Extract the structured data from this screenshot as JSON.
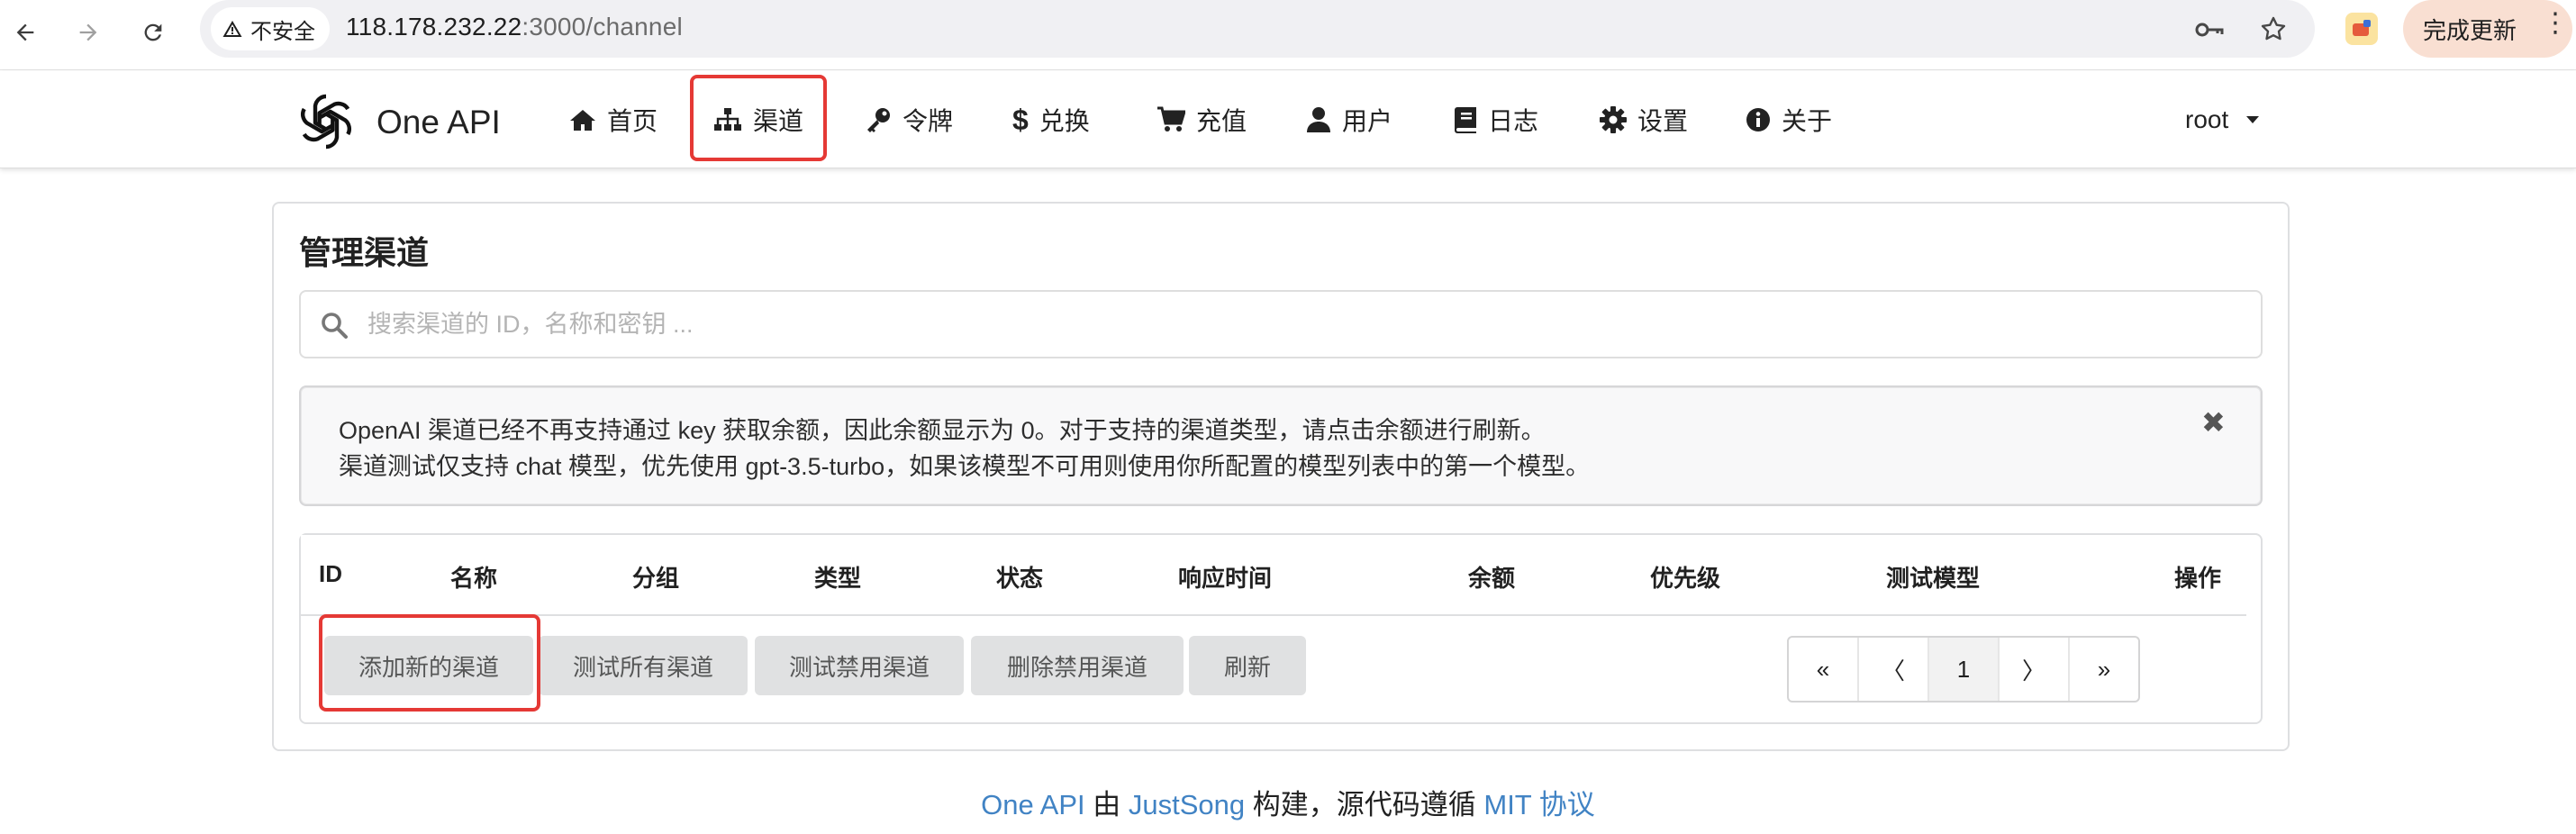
{
  "browser": {
    "security_label": "不安全",
    "url_host": "118.178.232.22",
    "url_rest": ":3000/channel",
    "update_button": "完成更新"
  },
  "header": {
    "logo_text": "One API",
    "menu": [
      {
        "label": "首页",
        "icon": "home-icon"
      },
      {
        "label": "渠道",
        "icon": "sitemap-icon"
      },
      {
        "label": "令牌",
        "icon": "key-icon"
      },
      {
        "label": "兑换",
        "icon": "dollar-icon"
      },
      {
        "label": "充值",
        "icon": "cart-icon"
      },
      {
        "label": "用户",
        "icon": "user-icon"
      },
      {
        "label": "日志",
        "icon": "book-icon"
      },
      {
        "label": "设置",
        "icon": "gear-icon"
      },
      {
        "label": "关于",
        "icon": "info-icon"
      }
    ],
    "user": "root"
  },
  "main": {
    "title": "管理渠道",
    "search_placeholder": "搜索渠道的 ID，名称和密钥 ...",
    "notice": [
      "OpenAI 渠道已经不再支持通过 key 获取余额，因此余额显示为 0。对于支持的渠道类型，请点击余额进行刷新。",
      "渠道测试仅支持 chat 模型，优先使用 gpt-3.5-turbo，如果该模型不可用则使用你所配置的模型列表中的第一个模型。"
    ],
    "columns": [
      "ID",
      "名称",
      "分组",
      "类型",
      "状态",
      "响应时间",
      "余额",
      "优先级",
      "测试模型",
      "操作"
    ],
    "buttons": [
      "添加新的渠道",
      "测试所有渠道",
      "测试禁用渠道",
      "删除禁用渠道",
      "刷新"
    ],
    "pagination": [
      "«",
      "〈",
      "1",
      "〉",
      "»"
    ]
  },
  "footer": {
    "link1": "One API",
    "text1": " 由 ",
    "link2": "JustSong",
    "text2": " 构建，源代码遵循 ",
    "link3": "MIT 协议"
  },
  "colors": {
    "highlight": "#e53935",
    "link": "#4183c4",
    "button_bg": "#e0e1e2"
  }
}
